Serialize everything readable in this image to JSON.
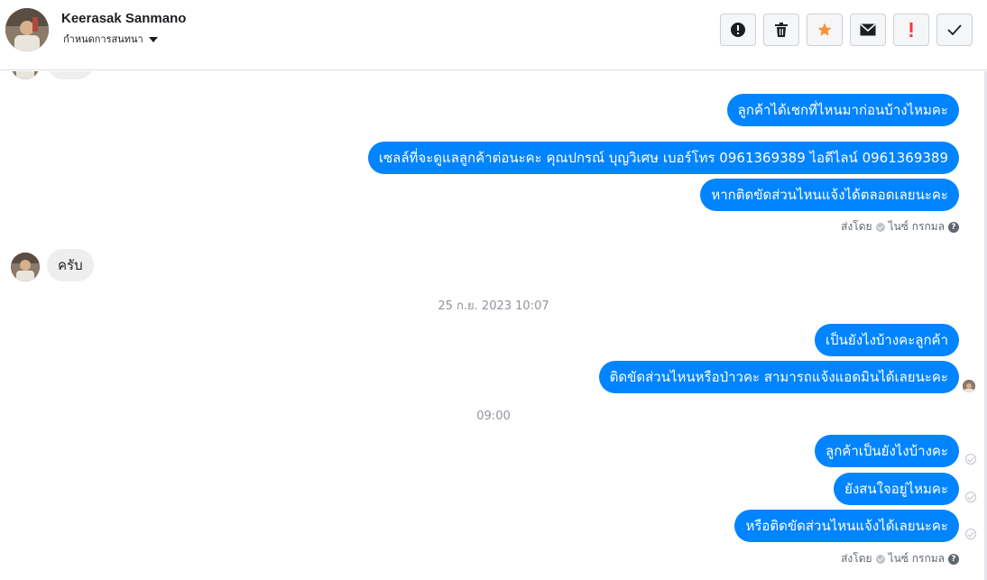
{
  "header": {
    "contact_name": "Keerasak Sanmano",
    "conversation_menu_label": "กำหนดการสนทนา",
    "actions": [
      {
        "name": "report-spam",
        "icon": "exclamation-circle-icon"
      },
      {
        "name": "delete",
        "icon": "trash-icon"
      },
      {
        "name": "star",
        "icon": "star-icon",
        "color": "#f7923b"
      },
      {
        "name": "mark-unread",
        "icon": "envelope-icon"
      },
      {
        "name": "follow-up",
        "icon": "exclamation-icon",
        "color": "#fa383e"
      },
      {
        "name": "mark-done",
        "icon": "check-icon"
      }
    ]
  },
  "messages": {
    "out_1": "ลูกค้าได้เชกที่ไหนมาก่อนบ้างไหมคะ",
    "out_2": "เซลล์ที่จะดูแลลูกค้าต่อนะคะ คุณปกรณ์ บุญวิเศษ เบอร์โทร 0961369389  ไอดีไลน์ 0961369389",
    "out_3": "หากติดขัดส่วนไหนแจ้งได้ตลอดเลยนะคะ",
    "sent_by_1": {
      "prefix": "ส่งโดย",
      "name": "ไนซ์ กรกมล",
      "help": "?"
    },
    "in_1": "ครับ",
    "timestamp_1": "25 ก.ย. 2023 10:07",
    "out_4": "เป็นยังไงบ้างคะลูกค้า",
    "out_5": "ติดขัดส่วนไหนหรือป่าวคะ สามารถแจ้งแอดมินได้เลยนะคะ",
    "timestamp_2": "09:00",
    "out_6": "ลูกค้าเป็นยังไงบ้างคะ",
    "out_7": "ยังสนใจอยู่ไหมคะ",
    "out_8": "หรือติดขัดส่วนไหนแจ้งได้เลยนะคะ",
    "sent_by_2": {
      "prefix": "ส่งโดย",
      "name": "ไนซ์ กรกมล",
      "help": "?"
    }
  },
  "colors": {
    "outgoing_bubble": "#0084ff",
    "incoming_bubble": "#eeeeee",
    "timestamp_text": "#90949c"
  }
}
